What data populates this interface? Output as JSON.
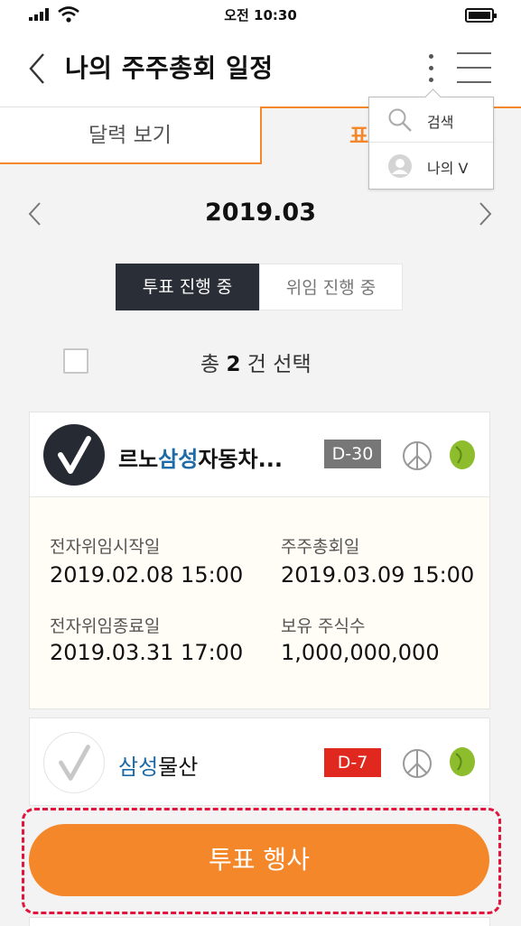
{
  "status_bar": {
    "time": "오전 10:30"
  },
  "header": {
    "title": "나의 주주총회 일정"
  },
  "tabs": [
    {
      "label": "달력 보기"
    },
    {
      "label": "표로 보기"
    }
  ],
  "menu": {
    "search_label": "검색",
    "my_label": "나의 V"
  },
  "month_nav": {
    "month": "2019.03"
  },
  "segment": {
    "vote_label": "투표 진행 중",
    "proxy_label": "위임 진행 중"
  },
  "selection": {
    "prefix": "총 ",
    "count": "2",
    "suffix": " 건 선택"
  },
  "cards": [
    {
      "name_prefix": "르노",
      "name_highlight": "삼성",
      "name_suffix": "자동차...",
      "dday": "D-30",
      "dday_color": "#777777",
      "details": [
        {
          "label": "전자위임시작일",
          "value": "2019.02.08 15:00"
        },
        {
          "label": "주주총회일",
          "value": "2019.03.09 15:00"
        },
        {
          "label": "전자위임종료일",
          "value": "2019.03.31 17:00"
        },
        {
          "label": "보유 주식수",
          "value": "1,000,000,000"
        }
      ]
    },
    {
      "name_prefix": "",
      "name_highlight": "삼성",
      "name_suffix": "물산",
      "dday": "D-7",
      "dday_color": "#e0281f"
    }
  ],
  "cta": {
    "label": "투표 행사"
  },
  "colors": {
    "accent": "#f4872a",
    "highlight_blue": "#1c6aa6",
    "dark": "#2a2e36",
    "dashed_border": "#e0143c"
  },
  "icons": [
    "signal-icon",
    "wifi-icon",
    "battery-icon",
    "back-arrow-icon",
    "more-vertical-icon",
    "menu-icon",
    "search-icon",
    "user-icon",
    "chevron-left-icon",
    "chevron-right-icon",
    "check-logo-icon",
    "peace-icon",
    "bean-icon"
  ]
}
